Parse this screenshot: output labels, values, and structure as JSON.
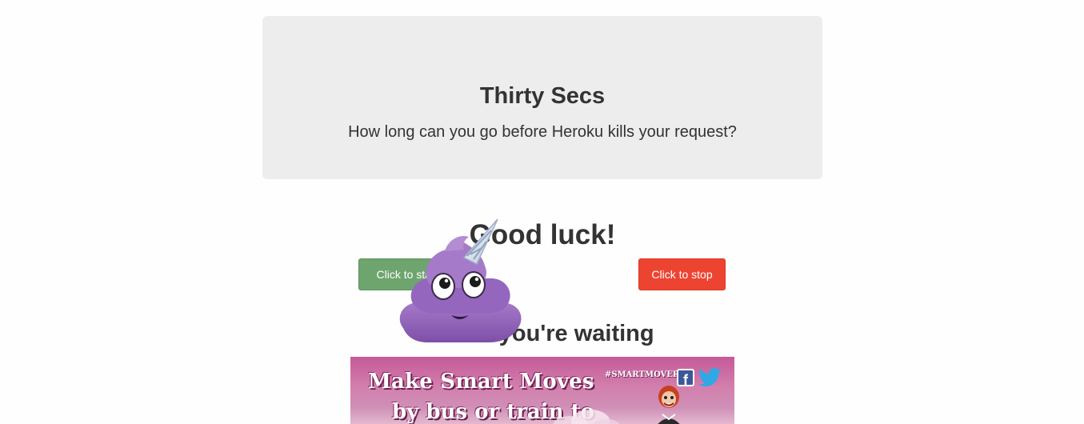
{
  "jumbotron": {
    "title": "Thirty Secs",
    "subtitle": "How long can you go before Heroku kills your request?"
  },
  "main": {
    "heading": "Good luck!",
    "start_button_label": "Click to start",
    "stop_button_label": "Click to stop",
    "waiting_heading": "While you're waiting"
  },
  "ad": {
    "line1": "Make Smart Moves",
    "line2": "by bus or train to",
    "hashtag": "#SMARTMOVERS",
    "facebook_glyph": "f",
    "icons": [
      "facebook-icon",
      "twitter-icon"
    ]
  },
  "overlay": {
    "icon": "unicorn-poo-emoji-icon"
  },
  "colors": {
    "start_button": "#6ea46e",
    "stop_button": "#ed4431",
    "jumbotron_bg": "#ededed",
    "ad_bg": "#c55a98"
  }
}
